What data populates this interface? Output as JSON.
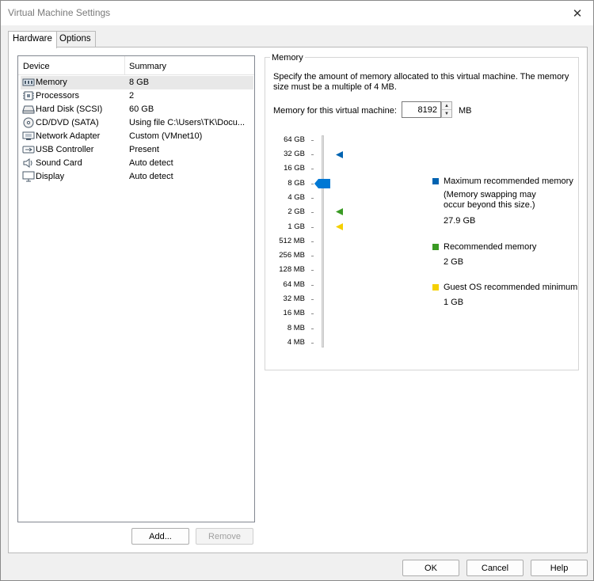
{
  "window": {
    "title": "Virtual Machine Settings"
  },
  "tabs": [
    {
      "label": "Hardware"
    },
    {
      "label": "Options"
    }
  ],
  "device_list": {
    "columns": {
      "device": "Device",
      "summary": "Summary"
    },
    "rows": [
      {
        "name": "Memory",
        "summary": "8 GB",
        "icon": "memory-icon"
      },
      {
        "name": "Processors",
        "summary": "2",
        "icon": "processor-icon"
      },
      {
        "name": "Hard Disk (SCSI)",
        "summary": "60 GB",
        "icon": "hard-disk-icon"
      },
      {
        "name": "CD/DVD (SATA)",
        "summary": "Using file C:\\Users\\TK\\Docu...",
        "icon": "cd-dvd-icon"
      },
      {
        "name": "Network Adapter",
        "summary": "Custom (VMnet10)",
        "icon": "network-adapter-icon"
      },
      {
        "name": "USB Controller",
        "summary": "Present",
        "icon": "usb-icon"
      },
      {
        "name": "Sound Card",
        "summary": "Auto detect",
        "icon": "speaker-icon"
      },
      {
        "name": "Display",
        "summary": "Auto detect",
        "icon": "monitor-icon"
      }
    ]
  },
  "buttons": {
    "add": "Add...",
    "remove": "Remove",
    "ok": "OK",
    "cancel": "Cancel",
    "help": "Help"
  },
  "memory": {
    "group_label": "Memory",
    "description": "Specify the amount of memory allocated to this virtual machine. The memory size must be a multiple of 4 MB.",
    "input_label": "Memory for this virtual machine:",
    "value": "8192",
    "unit": "MB",
    "ticks": [
      "64 GB",
      "32 GB",
      "16 GB",
      "8 GB",
      "4 GB",
      "2 GB",
      "1 GB",
      "512 MB",
      "256 MB",
      "128 MB",
      "64 MB",
      "32 MB",
      "16 MB",
      "8 MB",
      "4 MB"
    ],
    "legend": {
      "max": {
        "label": "Maximum recommended memory",
        "note": "(Memory swapping may occur beyond this size.)",
        "value": "27.9 GB",
        "color": "#0063b1"
      },
      "recommended": {
        "label": "Recommended memory",
        "value": "2 GB",
        "color": "#3a9a24"
      },
      "guest_min": {
        "label": "Guest OS recommended minimum",
        "value": "1 GB",
        "color": "#f5d000"
      }
    },
    "slider_thumb_color": "#0078d4"
  }
}
